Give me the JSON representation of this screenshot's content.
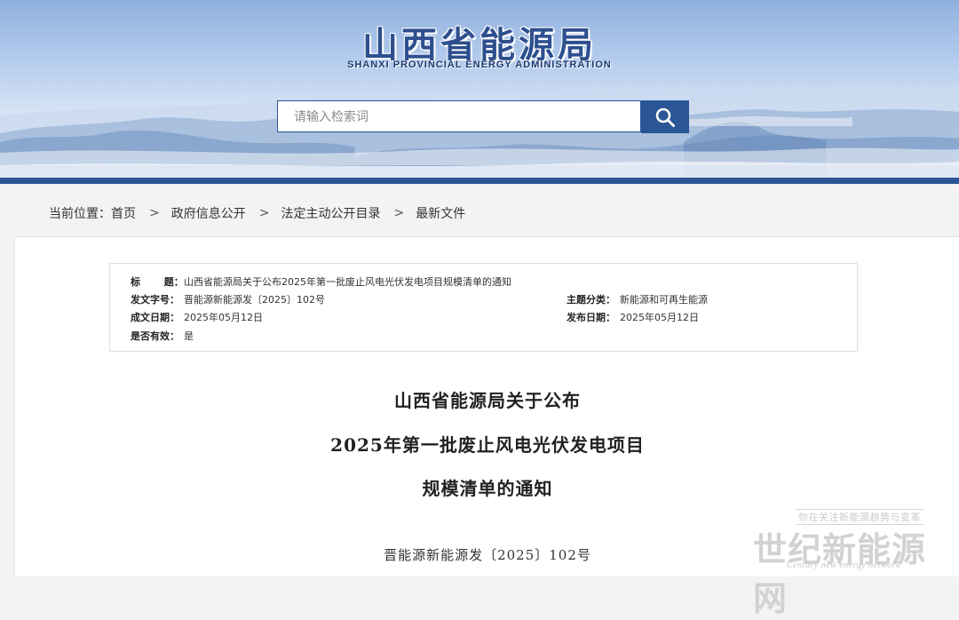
{
  "header": {
    "logo_cn": "山西省能源局",
    "logo_en": "SHANXI  PROVINCIAL  ENERGY  ADMINISTRATION",
    "search_placeholder": "请输入检索词",
    "search_icon": "magnifier-icon",
    "accent_color": "#2a5596"
  },
  "breadcrumb": {
    "label": "当前位置：",
    "items": [
      "首页",
      "政府信息公开",
      "法定主动公开目录",
      "最新文件"
    ],
    "separator": ">"
  },
  "meta": {
    "title_key": "标      题：",
    "title_value": "山西省能源局关于公布2025年第一批废止风电光伏发电项目规模清单的通知",
    "doc_no_key": "发文字号：",
    "doc_no_value": "晋能源新能源发〔2025〕102号",
    "topic_key": "主题分类：",
    "topic_value": "新能源和可再生能源",
    "made_key": "成文日期：",
    "made_value": "2025年05月12日",
    "pub_key": "发布日期：",
    "pub_value": "2025年05月12日",
    "valid_key": "是否有效：",
    "valid_value": "是"
  },
  "document": {
    "title_lines": [
      "山西省能源局关于公布",
      "2025年第一批废止风电光伏发电项目",
      "规模清单的通知"
    ],
    "doc_number": "晋能源新能源发〔2025〕102号"
  },
  "watermark": {
    "slogan": "你在关注新能源趋势与变革",
    "name": "世纪新能源网",
    "name_en": "Century new energy network"
  }
}
